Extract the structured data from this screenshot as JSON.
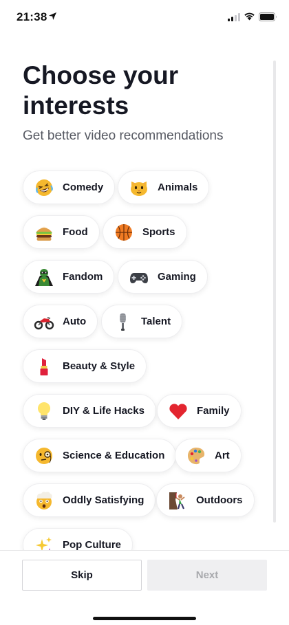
{
  "status_bar": {
    "time": "21:38"
  },
  "header": {
    "title": "Choose your interests",
    "subtitle": "Get better video recommendations"
  },
  "interests": [
    {
      "label": "Comedy",
      "icon": "laughing-face-icon"
    },
    {
      "label": "Animals",
      "icon": "cat-face-icon"
    },
    {
      "label": "Food",
      "icon": "burger-icon"
    },
    {
      "label": "Sports",
      "icon": "basketball-icon"
    },
    {
      "label": "Fandom",
      "icon": "superhero-icon"
    },
    {
      "label": "Gaming",
      "icon": "game-controller-icon"
    },
    {
      "label": "Auto",
      "icon": "motorcycle-icon"
    },
    {
      "label": "Talent",
      "icon": "microphone-icon"
    },
    {
      "label": "Beauty & Style",
      "icon": "lipstick-icon"
    },
    {
      "label": "DIY & Life Hacks",
      "icon": "light-bulb-icon"
    },
    {
      "label": "Family",
      "icon": "heart-icon"
    },
    {
      "label": "Science & Education",
      "icon": "monocle-face-icon"
    },
    {
      "label": "Art",
      "icon": "palette-icon"
    },
    {
      "label": "Oddly Satisfying",
      "icon": "exploding-head-icon"
    },
    {
      "label": "Outdoors",
      "icon": "rock-climbing-icon"
    },
    {
      "label": "Pop Culture",
      "icon": "sparkles-icon"
    }
  ],
  "footer": {
    "skip_label": "Skip",
    "next_label": "Next"
  }
}
